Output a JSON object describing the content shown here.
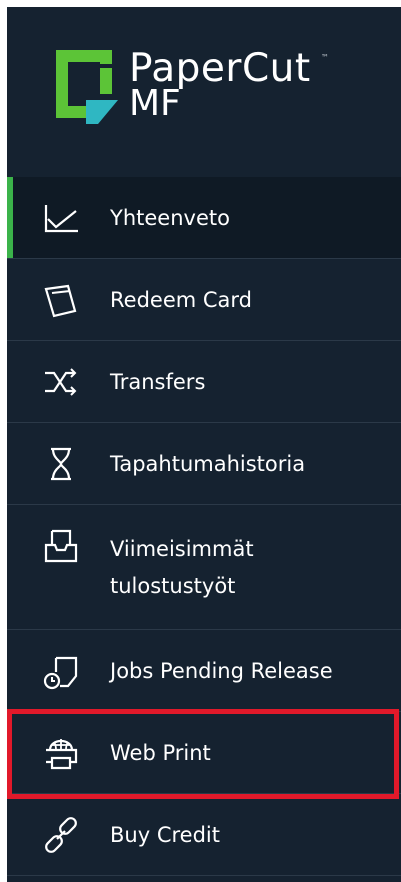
{
  "brand": {
    "name": "PaperCut",
    "trademark": "™",
    "product": "MF",
    "colors": {
      "green": "#5cc437",
      "teal": "#2fb7c2"
    }
  },
  "menu": {
    "items": [
      {
        "label": "Yhteenveto",
        "icon": "line-chart-icon"
      },
      {
        "label": "Redeem Card",
        "icon": "card-icon"
      },
      {
        "label": "Transfers",
        "icon": "transfer-arrows-icon"
      },
      {
        "label": "Tapahtumahistoria",
        "icon": "hourglass-icon"
      },
      {
        "label": "Viimeisimmät tulostustyöt",
        "icon": "printer-tray-icon"
      },
      {
        "label": "Jobs Pending Release",
        "icon": "release-document-icon"
      },
      {
        "label": "Web Print",
        "icon": "web-print-icon"
      },
      {
        "label": "Buy Credit",
        "icon": "chain-link-icon"
      }
    ],
    "active_index": 0,
    "highlighted_index": 6
  },
  "colors": {
    "sidebar_bg": "#152230",
    "active_accent": "#3bb34a",
    "highlight_border": "#e1192a"
  }
}
